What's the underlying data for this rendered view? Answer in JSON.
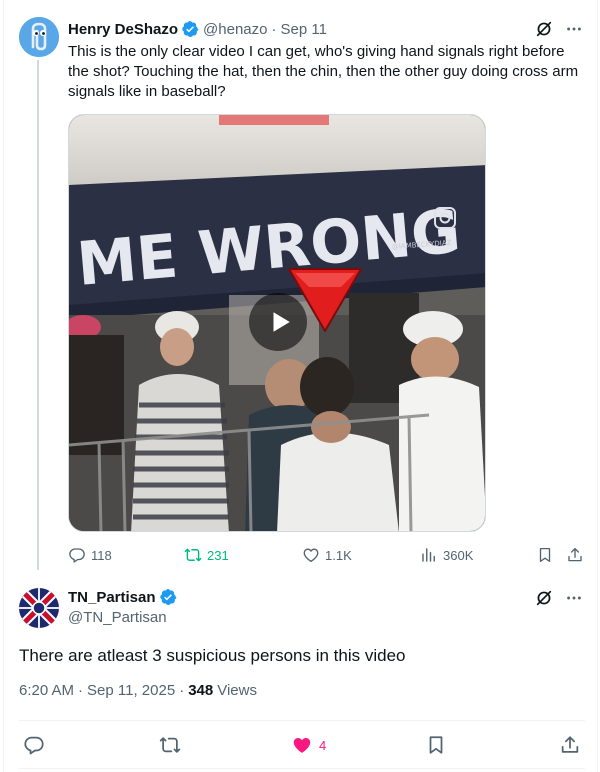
{
  "parent_tweet": {
    "author": {
      "display_name": "Henry DeShazo",
      "handle": "@henazo",
      "verified": true,
      "avatar_icon": "paperclip-avatar-icon"
    },
    "separator": "·",
    "date": "Sep 11",
    "text": "This is the only clear video I can get, who's giving hand signals right before the shot? Touching the hat, then the chin, then the other guy doing cross arm signals like in baseball?",
    "media": {
      "type": "video",
      "banner_text": "ME WRONG",
      "watermark": "@IAMBECKYDIAZ",
      "overlay_icon": "red-triangle-down-icon"
    },
    "metrics": {
      "replies": "118",
      "reposts": "231",
      "likes": "1.1K",
      "views": "360K"
    }
  },
  "reply": {
    "author": {
      "display_name": "TN_Partisan",
      "handle": "@TN_Partisan",
      "verified": true,
      "avatar_icon": "tennessee-flag-avatar-icon"
    },
    "text": "There are atleast 3 suspicious persons in this video",
    "time": "6:20 AM",
    "separator": "·",
    "date": "Sep 11, 2025",
    "views_count": "348",
    "views_label": "Views",
    "actions": {
      "likes": "4",
      "liked": true
    }
  },
  "colors": {
    "text_primary": "#0f1419",
    "text_secondary": "#536471",
    "verified_blue": "#1d9bf0",
    "repost_green": "#00ba7c",
    "like_pink": "#f91880",
    "border": "#eff3f4"
  }
}
